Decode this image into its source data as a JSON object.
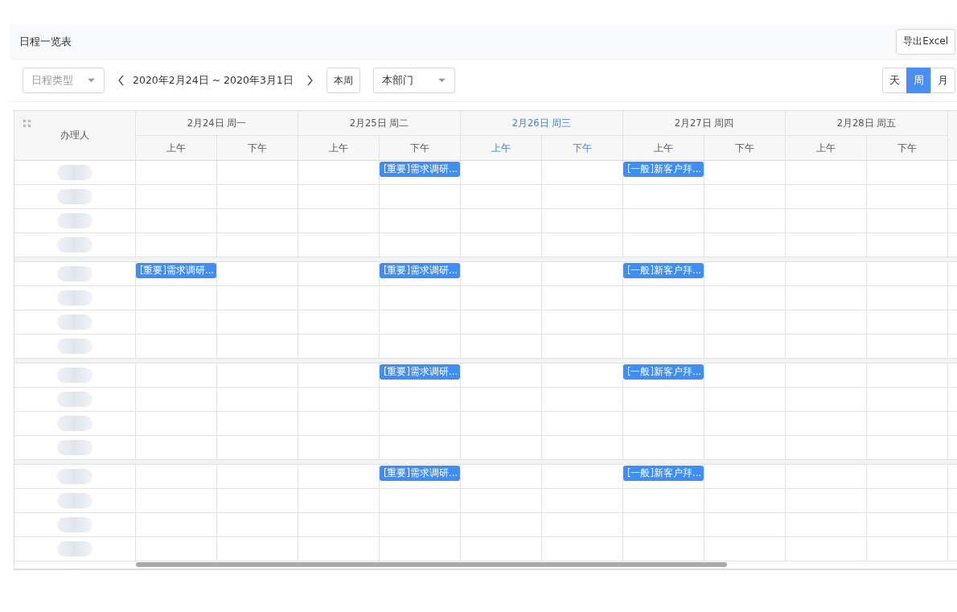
{
  "header": {
    "title": "日程一览表",
    "export_button": "导出Excel"
  },
  "toolbar": {
    "type_filter": {
      "placeholder": "日程类型"
    },
    "date_range": "2020年2月24日 ~ 2020年3月1日",
    "this_week_button": "本周",
    "department_filter": {
      "value": "本部门"
    },
    "view_modes": [
      {
        "label": "天",
        "selected": false
      },
      {
        "label": "周",
        "selected": true
      },
      {
        "label": "月",
        "selected": false
      }
    ]
  },
  "table": {
    "person_column": "办理人",
    "days": [
      {
        "label": "2月24日 周一",
        "today": false,
        "halves": [
          "上午",
          "下午"
        ]
      },
      {
        "label": "2月25日 周二",
        "today": false,
        "halves": [
          "上午",
          "下午"
        ]
      },
      {
        "label": "2月26日 周三",
        "today": true,
        "halves": [
          "上午",
          "下午"
        ]
      },
      {
        "label": "2月27日 周四",
        "today": false,
        "halves": [
          "上午",
          "下午"
        ]
      },
      {
        "label": "2月28日 周五",
        "today": false,
        "halves": [
          "上午",
          "下午"
        ]
      }
    ],
    "groups": [
      {
        "rows": [
          {
            "name_redacted": true,
            "day2_pm": "[重要]需求调研...",
            "day4_am": "[一般]新客户拜..."
          },
          {
            "name_redacted": true
          },
          {
            "name_redacted": true
          },
          {
            "name_redacted": true
          }
        ]
      },
      {
        "rows": [
          {
            "name_redacted": true,
            "day1_am": "[重要]需求调研...",
            "day2_pm": "[重要]需求调研...",
            "day4_am": "[一般]新客户拜..."
          },
          {
            "name_redacted": true
          },
          {
            "name_redacted": true
          },
          {
            "name_redacted": true
          }
        ]
      },
      {
        "rows": [
          {
            "name_redacted": true,
            "day2_pm": "[重要]需求调研...",
            "day4_am": "[一般]新客户拜..."
          },
          {
            "name_redacted": true
          },
          {
            "name_redacted": true
          },
          {
            "name_redacted": true
          }
        ]
      },
      {
        "rows": [
          {
            "name_redacted": true,
            "day2_pm": "[重要]需求调研...",
            "day4_am": "[一般]新客户拜..."
          },
          {
            "name_redacted": true
          },
          {
            "name_redacted": true
          },
          {
            "name_redacted": true
          }
        ]
      }
    ]
  }
}
